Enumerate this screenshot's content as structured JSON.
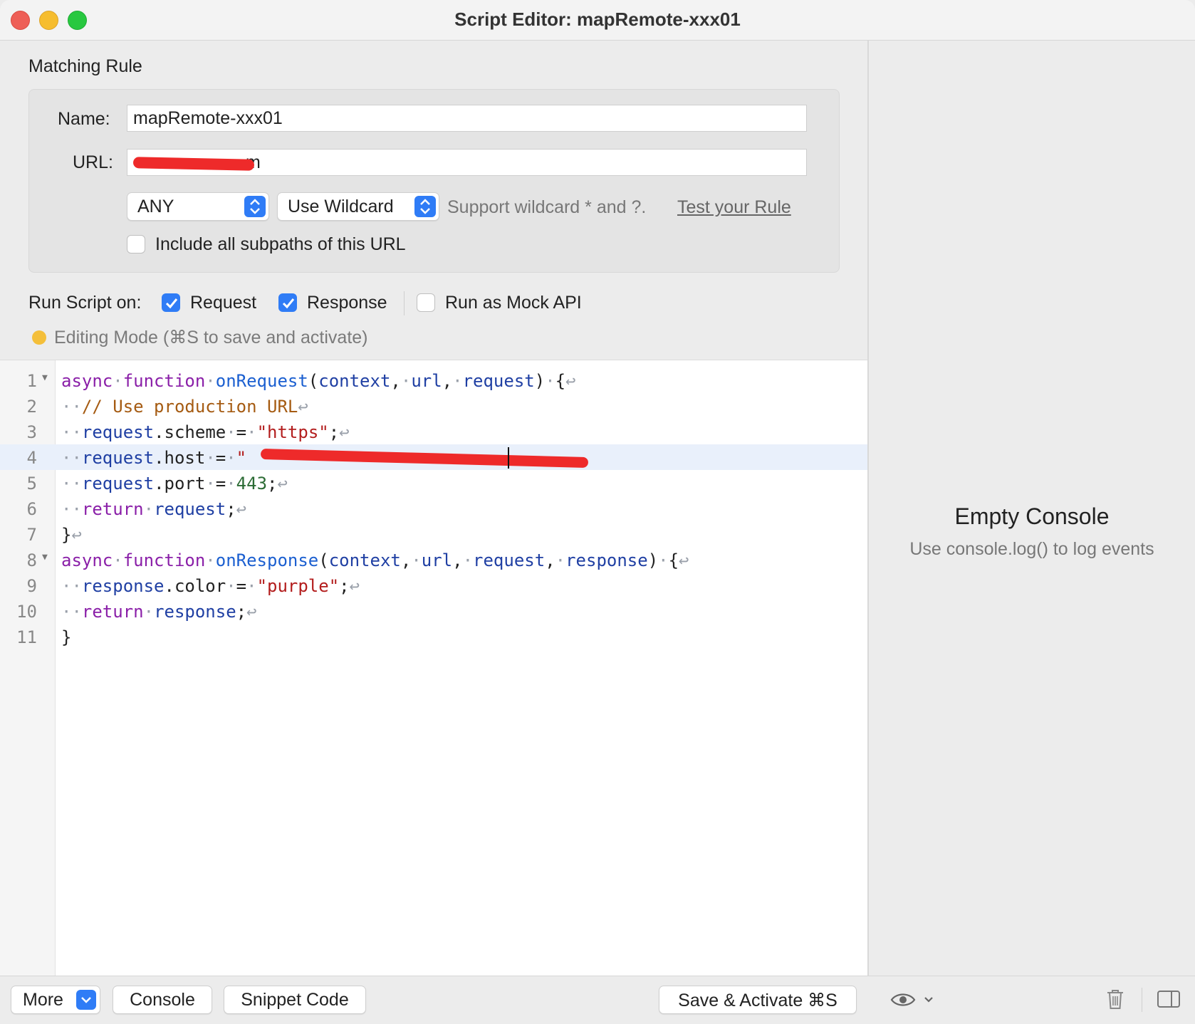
{
  "window": {
    "title": "Script Editor: mapRemote-xxx01"
  },
  "rule": {
    "section_title": "Matching Rule",
    "name_label": "Name:",
    "name_value": "mapRemote-xxx01",
    "url_label": "URL:",
    "url_value_visible": "m",
    "method_select": "ANY",
    "match_mode_select": "Use Wildcard",
    "hint": "Support wildcard * and ?.",
    "test_link": "Test your Rule",
    "include_subpaths_label": "Include all subpaths of this URL",
    "include_subpaths_checked": false
  },
  "run_on": {
    "label": "Run Script on:",
    "request_label": "Request",
    "request_checked": true,
    "response_label": "Response",
    "response_checked": true,
    "mock_label": "Run as Mock API",
    "mock_checked": false
  },
  "status": {
    "dot_color": "#f4bf3a",
    "text": "Editing Mode (⌘S to save and activate)"
  },
  "editor": {
    "active_line": 4,
    "lines": [
      {
        "n": "1",
        "fold": true
      },
      {
        "n": "2",
        "fold": false
      },
      {
        "n": "3",
        "fold": false
      },
      {
        "n": "4",
        "fold": false
      },
      {
        "n": "5",
        "fold": false
      },
      {
        "n": "6",
        "fold": false
      },
      {
        "n": "7",
        "fold": false
      },
      {
        "n": "8",
        "fold": true
      },
      {
        "n": "9",
        "fold": false
      },
      {
        "n": "10",
        "fold": false
      },
      {
        "n": "11",
        "fold": false
      }
    ],
    "tokens": {
      "async": "async",
      "function": "function",
      "onRequest": "onRequest",
      "onResponse": "onResponse",
      "context": "context",
      "url": "url",
      "request": "request",
      "response": "response",
      "comment": "// Use production URL",
      "scheme": "scheme",
      "https": "\"https\"",
      "host": "host",
      "host_value_visible": "\"",
      "port": "port",
      "port_value": "443",
      "return": "return",
      "color": "color",
      "purple": "\"purple\""
    }
  },
  "console": {
    "title": "Empty Console",
    "subtitle": "Use console.log() to log events"
  },
  "bottom": {
    "more": "More",
    "console": "Console",
    "snippet": "Snippet Code",
    "save": "Save & Activate ⌘S"
  },
  "colors": {
    "accent": "#2f7cf6",
    "redaction": "#ee2a2a",
    "active_line_bg": "#e9f0fb"
  },
  "icons": [
    "eye-icon",
    "chevron-down-icon",
    "trash-icon",
    "sidebar-toggle-icon",
    "checkmark-icon",
    "stepper-icon"
  ]
}
